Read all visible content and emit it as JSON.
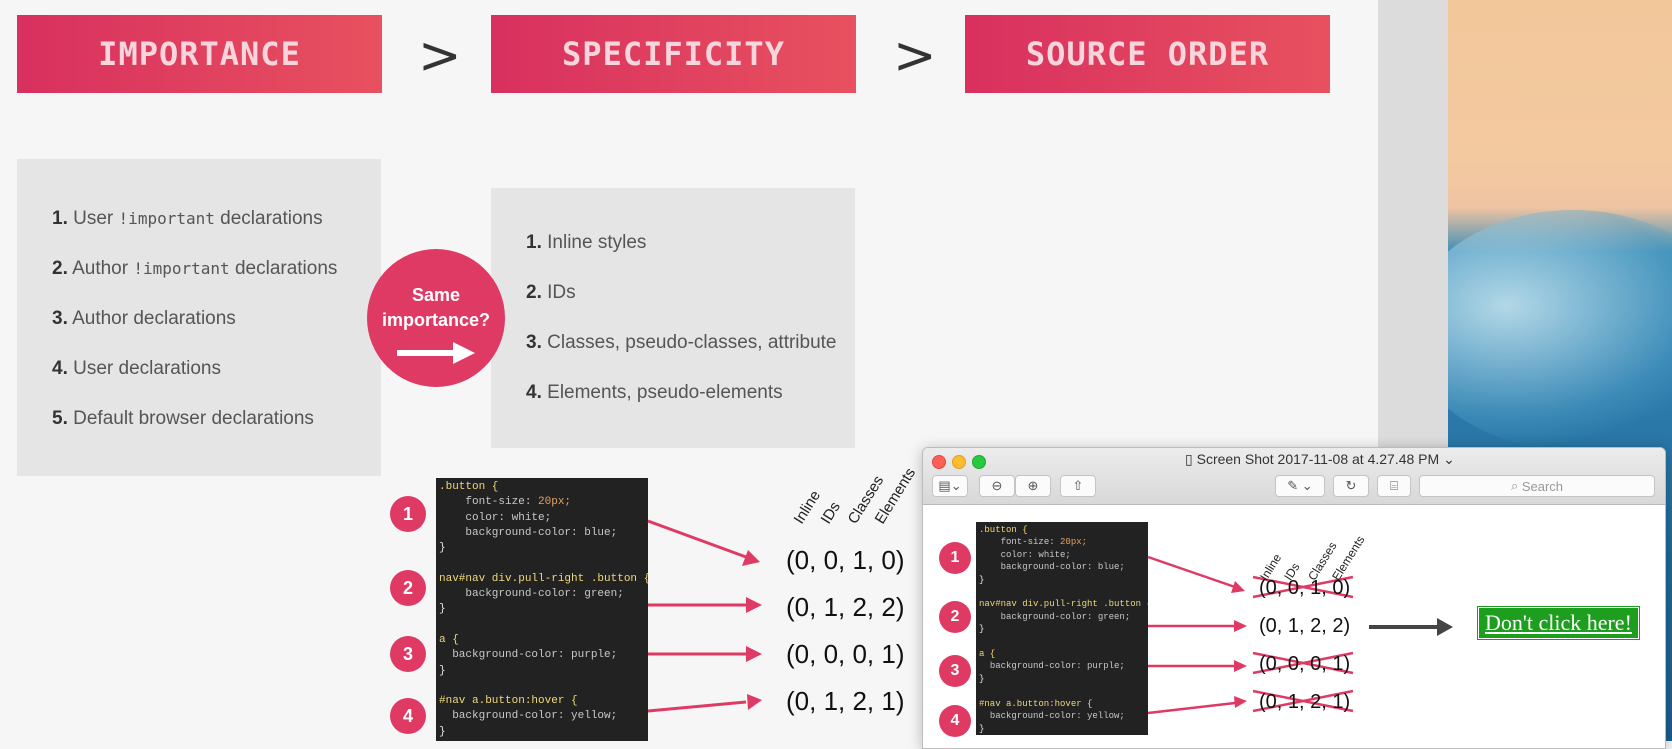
{
  "banners": {
    "importance": "IMPORTANCE",
    "specificity": "SPECIFICITY",
    "source_order": "SOURCE ORDER",
    "gt1": ">",
    "gt2": ">"
  },
  "importance_list": [
    {
      "num": "1.",
      "pre": "User ",
      "code": "!important",
      "post": " declarations"
    },
    {
      "num": "2.",
      "pre": "Author ",
      "code": "!important",
      "post": " declarations"
    },
    {
      "num": "3.",
      "pre": "Author declarations",
      "code": "",
      "post": ""
    },
    {
      "num": "4.",
      "pre": "User declarations",
      "code": "",
      "post": ""
    },
    {
      "num": "5.",
      "pre": "Default browser declarations",
      "code": "",
      "post": ""
    }
  ],
  "specificity_list": [
    {
      "num": "1.",
      "text": "Inline styles"
    },
    {
      "num": "2.",
      "text": "IDs"
    },
    {
      "num": "3.",
      "text": "Classes, pseudo-classes, attribute"
    },
    {
      "num": "4.",
      "text": "Elements, pseudo-elements"
    }
  ],
  "same_importance": {
    "line1": "Same",
    "line2": "importance?"
  },
  "badges": [
    "1",
    "2",
    "3",
    "4"
  ],
  "headers": [
    "Inline",
    "IDs",
    "Classes",
    "Elements"
  ],
  "specificities": [
    "(0, 0, 1, 0)",
    "(0, 1, 2, 2)",
    "(0, 0, 0, 1)",
    "(0, 1, 2, 1)"
  ],
  "code_lines": [
    ".button {",
    "    font-size: 20px;",
    "    color: white;",
    "    background-color: blue;",
    "}",
    "",
    "nav#nav div.pull-right .button {",
    "    background-color: green;",
    "}",
    "",
    "a {",
    "  background-color: purple;",
    "}",
    "",
    "#nav a.button:hover {",
    "  background-color: yellow;",
    "}"
  ],
  "preview": {
    "title": "Screen Shot 2017-11-08 at 4.27.48 PM",
    "search_placeholder": "Search",
    "result": "Don't click here!"
  },
  "colors": {
    "accent": "#de3a64",
    "banner_start": "#d8305f",
    "banner_end": "#e8515f",
    "code_bg": "#222222",
    "result_green": "#1e9e1e"
  }
}
